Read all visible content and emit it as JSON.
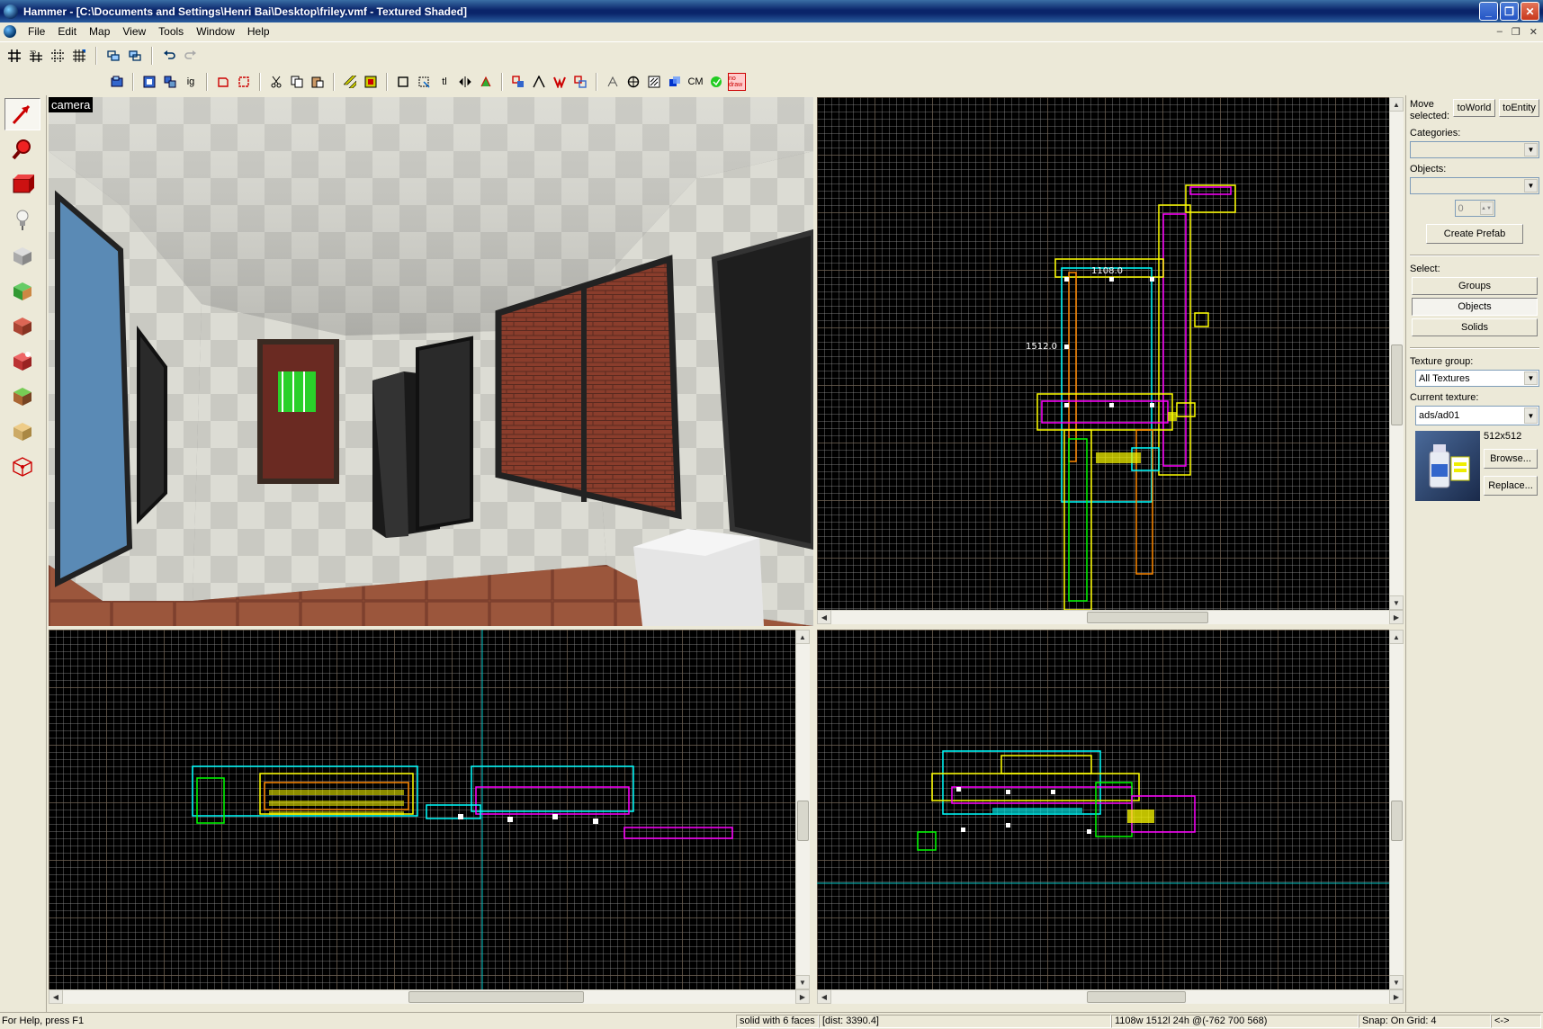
{
  "window": {
    "title": "Hammer - [C:\\Documents and Settings\\Henri Bai\\Desktop\\friley.vmf - Textured Shaded]",
    "minimize": "_",
    "restore": "❐",
    "close": "✕"
  },
  "menu": {
    "items": [
      "File",
      "Edit",
      "Map",
      "View",
      "Tools",
      "Window",
      "Help"
    ],
    "mdi_minimize": "–",
    "mdi_restore": "❐",
    "mdi_close": "✕"
  },
  "toolbar2": {
    "ig_label": "ig",
    "tl_label": "tl",
    "cm_label": "CM",
    "nodraw_label": "no draw"
  },
  "camera": {
    "label": "camera"
  },
  "top_view": {
    "dim_width_label": "1108.0",
    "dim_height_label": "1512.0"
  },
  "right_panel": {
    "move_selected_label": "Move selected:",
    "to_world": "toWorld",
    "to_entity": "toEntity",
    "categories_label": "Categories:",
    "objects_label": "Objects:",
    "spin_value": "0",
    "create_prefab": "Create Prefab",
    "select_label": "Select:",
    "groups": "Groups",
    "objects": "Objects",
    "solids": "Solids",
    "texture_group_label": "Texture group:",
    "texture_group_value": "All Textures",
    "current_texture_label": "Current texture:",
    "current_texture_value": "ads/ad01",
    "texture_size": "512x512",
    "browse": "Browse...",
    "replace": "Replace..."
  },
  "status": {
    "help": "For Help, press F1",
    "selection": "solid with 6 faces",
    "dist": "[dist: 3390.4]",
    "size": "1108w 1512l 24h @(-762 700 568)",
    "snap": "Snap: On Grid: 4",
    "last": "<->"
  },
  "colors": {
    "title_bar": "#0a246a",
    "chrome": "#ece9d8",
    "grid_bg": "#000000",
    "brush_yellow": "#ffff00",
    "brush_cyan": "#00ffff",
    "brush_magenta": "#ff00ff",
    "brush_white": "#ffffff"
  }
}
